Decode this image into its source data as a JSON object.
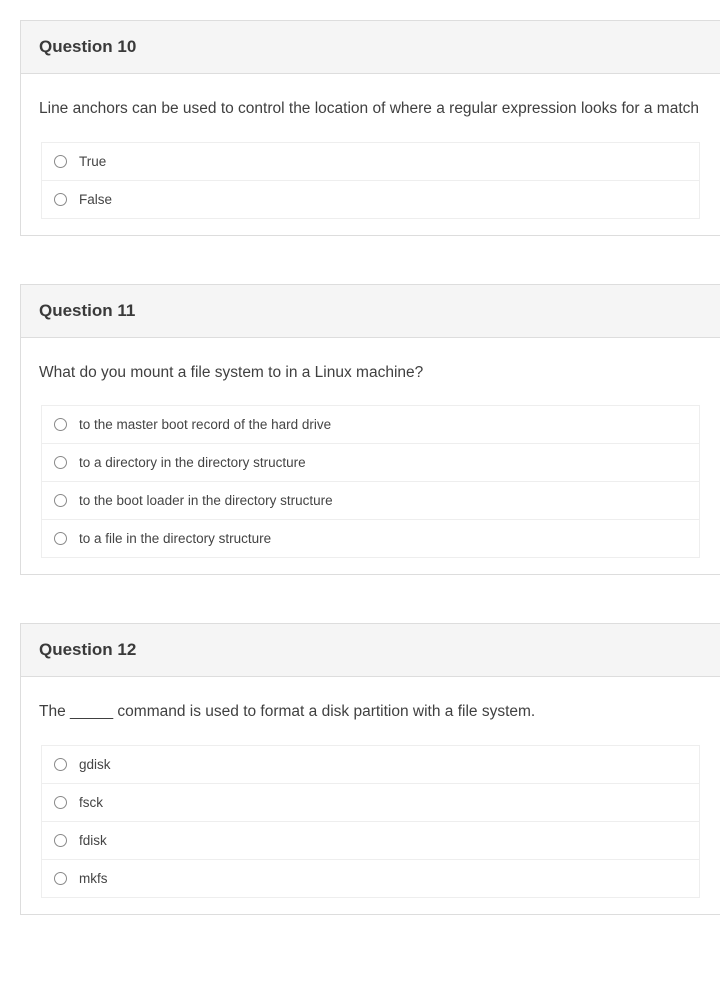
{
  "questions": [
    {
      "title": "Question 10",
      "prompt": "Line anchors can be used to control the location of where a regular expression looks for a match",
      "options": [
        "True",
        "False"
      ]
    },
    {
      "title": "Question 11",
      "prompt": "What do you mount a file system to in a Linux machine?",
      "options": [
        "to the master boot record of the hard drive",
        "to a directory in the directory structure",
        "to the boot loader in the directory structure",
        "to a file in the directory structure"
      ]
    },
    {
      "title": "Question 12",
      "prompt": "The _____ command is used to format a disk partition with a file system.",
      "options": [
        "gdisk",
        "fsck",
        "fdisk",
        "mkfs"
      ]
    }
  ]
}
